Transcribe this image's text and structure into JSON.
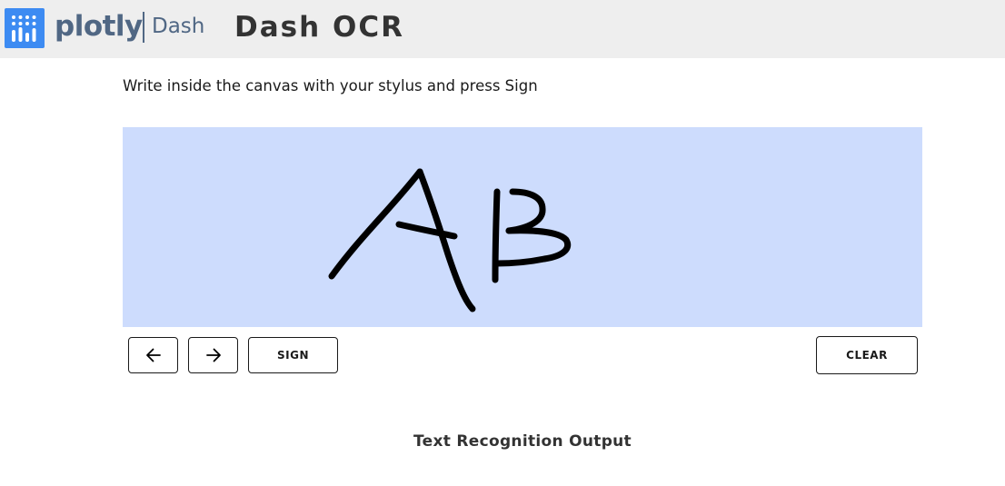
{
  "header": {
    "brand_name": "plotly",
    "brand_product": "Dash",
    "app_title": "Dash OCR",
    "logo_icon": "plotly-bars-logo-icon",
    "colors": {
      "bar": "#eeeeee",
      "logo_tile": "#3d8bf2",
      "brand_text": "#506784"
    }
  },
  "main": {
    "instructions": "Write inside the canvas with your stylus and press Sign",
    "canvas": {
      "background": "#cddcfd",
      "stroke_color": "#000000"
    },
    "toolbar": {
      "prev_icon": "arrow-left-icon",
      "next_icon": "arrow-right-icon",
      "sign_label": "SIGN",
      "clear_label": "CLEAR"
    },
    "output_heading": "Text Recognition Output"
  }
}
